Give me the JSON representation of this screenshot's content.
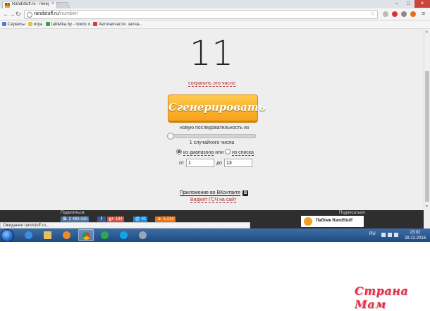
{
  "browser": {
    "tab_title": "RandStuff.ru - генератор",
    "tab_favicon": "RS",
    "url_domain": "randstuff.ru",
    "url_path": "/number/",
    "bookmarks": [
      {
        "label": "Сервисы",
        "icon": "apps-grid-icon",
        "color": "#4a7fd4"
      },
      {
        "label": "игра",
        "icon": "folder-icon",
        "color": "#e9c046"
      },
      {
        "label": "tabletka.by - поиск л...",
        "icon": "tabletka-favicon",
        "color": "#3aa04a"
      },
      {
        "label": "Автозапчасти, запча...",
        "icon": "autoparts-favicon",
        "color": "#c94040"
      }
    ]
  },
  "generator": {
    "number": "11",
    "save_link": "сохранить это число",
    "generate_button": "Сгенерировать",
    "sequence_label": "новую последовательность из",
    "count_label": "1 случайного числа",
    "slider_value": 0,
    "mode_range": "из диапазона",
    "mode_or": "или",
    "mode_list": "из списка",
    "from_label": "от",
    "from_value": "1",
    "to_label": "до",
    "to_value": "13"
  },
  "links": {
    "vk_app": "Приложение во ВКонтакте",
    "vk_badge": "В",
    "widget": "Виджет ГСЧ на сайт"
  },
  "footer": {
    "share_label": "Поделиться:",
    "subscribe_label": "Подписаться:",
    "shares": [
      {
        "icon": "vk-icon",
        "glyph": "В",
        "count": "2 483 520",
        "color": "#4c75a3"
      },
      {
        "icon": "facebook-icon",
        "glyph": "f",
        "count": "",
        "color": "#3b5998"
      },
      {
        "icon": "google-plus-icon",
        "glyph": "g+",
        "count": "184",
        "color": "#dd4b39"
      },
      {
        "icon": "mailru-icon",
        "glyph": "@",
        "count": "41",
        "color": "#168de2"
      },
      {
        "icon": "odnoklassniki-icon",
        "glyph": "о",
        "count": "5 214",
        "color": "#f2720c"
      }
    ],
    "public_name": "Паблик RandStuff"
  },
  "status_text": "Ожидание randstuff.ru...",
  "taskbar": {
    "lang": "RU",
    "time": "23:02",
    "date": "28.12.2016"
  },
  "watermark": "Страна Мам"
}
